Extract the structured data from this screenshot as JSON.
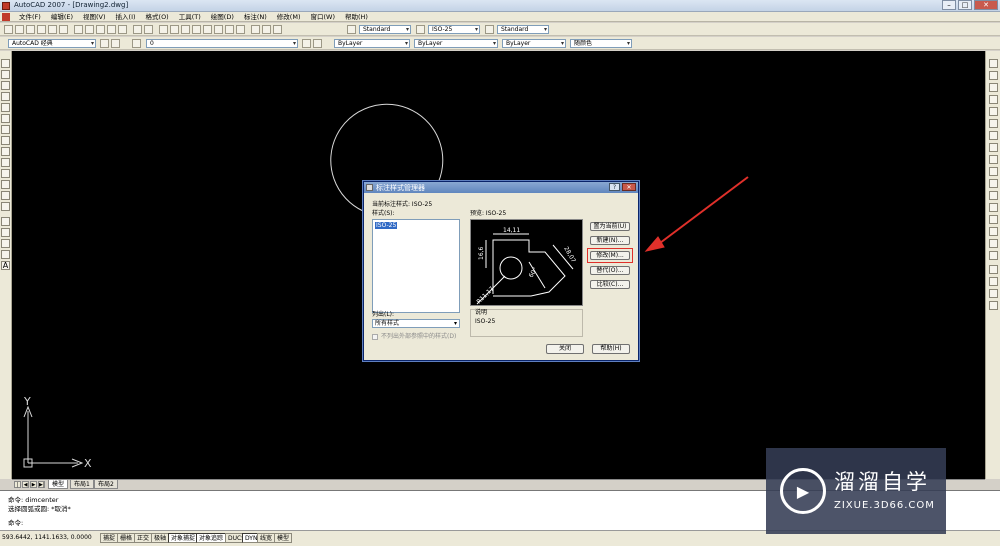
{
  "window": {
    "title": "AutoCAD 2007 - [Drawing2.dwg]"
  },
  "menu": [
    "文件(F)",
    "编辑(E)",
    "视图(V)",
    "插入(I)",
    "格式(O)",
    "工具(T)",
    "绘图(D)",
    "标注(N)",
    "修改(M)",
    "窗口(W)",
    "帮助(H)"
  ],
  "toolbar1": {
    "textstyle": "Standard",
    "dimstyle": "ISO-25",
    "tablestyle": "Standard"
  },
  "toolbar2": {
    "workspace": "AutoCAD 经典",
    "layer": "0",
    "color": "ByLayer",
    "linetype": "ByLayer",
    "lineweight": "ByLayer",
    "plotstyle": "随颜色"
  },
  "layout_tabs": [
    "模型",
    "布局1",
    "布局2"
  ],
  "command": {
    "line1": "命令:  dimcenter",
    "line2": "选择圆弧或圆: *取消*",
    "prompt": "命令:"
  },
  "status": {
    "coords": "593.6442,  1141.1633, 0.0000",
    "toggles": [
      "捕捉",
      "栅格",
      "正交",
      "极轴",
      "对象捕捉",
      "对象追踪",
      "DUCS",
      "DYN",
      "线宽",
      "模型"
    ]
  },
  "axes": {
    "x": "X",
    "y": "Y"
  },
  "dialog": {
    "title": "标注样式管理器",
    "current_style_label": "当前标注样式: ISO-25",
    "styles_label": "样式(S):",
    "styles": [
      "ISO-25"
    ],
    "preview_label": "预览: ISO-25",
    "list_label": "列出(L):",
    "list_value": "所有样式",
    "checkbox_label": "不列出外部参照中的样式(D)",
    "description_label": "说明",
    "description_value": "ISO-25",
    "buttons": {
      "set_current": "置为当前(U)",
      "new": "新建(N)...",
      "modify": "修改(M)...",
      "override": "替代(O)...",
      "compare": "比较(C)...",
      "close": "关闭",
      "help": "帮助(H)"
    },
    "preview_dims": {
      "top": "14,11",
      "left": "16,6",
      "right": "28,07",
      "diag": "60°",
      "radius": "R11,17"
    }
  },
  "watermark": {
    "cn": "溜溜自学",
    "url": "ZIXUE.3D66.COM"
  },
  "colors": {
    "canvas": "#000000",
    "annotation_arrow": "#e0302a",
    "watermark_bg": "#343c54"
  }
}
